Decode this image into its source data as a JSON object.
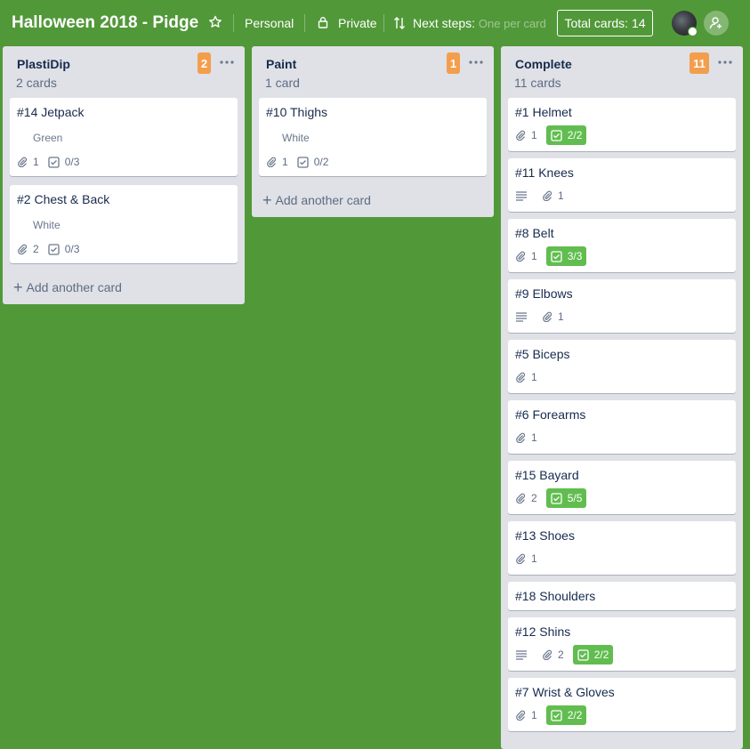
{
  "board": {
    "title": "Halloween 2018 - Pidge",
    "team": "Personal",
    "visibility": "Private",
    "next_steps_label": "Next steps:",
    "next_steps_value": "One per card",
    "total_cards": "Total cards: 14"
  },
  "colors": {
    "background": "#519839",
    "count_badge": "#f29e4c",
    "checklist_complete": "#61bd4f"
  },
  "lists": [
    {
      "title": "PlastiDip",
      "count_text": "2 cards",
      "badge": "2",
      "add_card": "Add another card",
      "cards": [
        {
          "title": "#14 Jetpack",
          "label": "Green",
          "attachments": "1",
          "checklist": "0/3"
        },
        {
          "title": "#2 Chest & Back",
          "label": "White",
          "attachments": "2",
          "checklist": "0/3"
        }
      ]
    },
    {
      "title": "Paint",
      "count_text": "1 card",
      "badge": "1",
      "add_card": "Add another card",
      "cards": [
        {
          "title": "#10 Thighs",
          "label": "White",
          "attachments": "1",
          "checklist": "0/2"
        }
      ]
    },
    {
      "title": "Complete",
      "count_text": "11 cards",
      "badge": "11",
      "cards": [
        {
          "title": "#1 Helmet",
          "attachments": "1",
          "checklist": "2/2"
        },
        {
          "title": "#11 Knees",
          "description": true,
          "attachments": "1"
        },
        {
          "title": "#8 Belt",
          "attachments": "1",
          "checklist": "3/3"
        },
        {
          "title": "#9 Elbows",
          "description": true,
          "attachments": "1"
        },
        {
          "title": "#5 Biceps",
          "attachments": "1"
        },
        {
          "title": "#6 Forearms",
          "attachments": "1"
        },
        {
          "title": "#15 Bayard",
          "attachments": "2",
          "checklist": "5/5"
        },
        {
          "title": "#13 Shoes",
          "attachments": "1"
        },
        {
          "title": "#18 Shoulders"
        },
        {
          "title": "#12 Shins",
          "description": true,
          "attachments": "2",
          "checklist": "2/2"
        },
        {
          "title": "#7 Wrist & Gloves",
          "attachments": "1",
          "checklist": "2/2"
        }
      ]
    }
  ]
}
